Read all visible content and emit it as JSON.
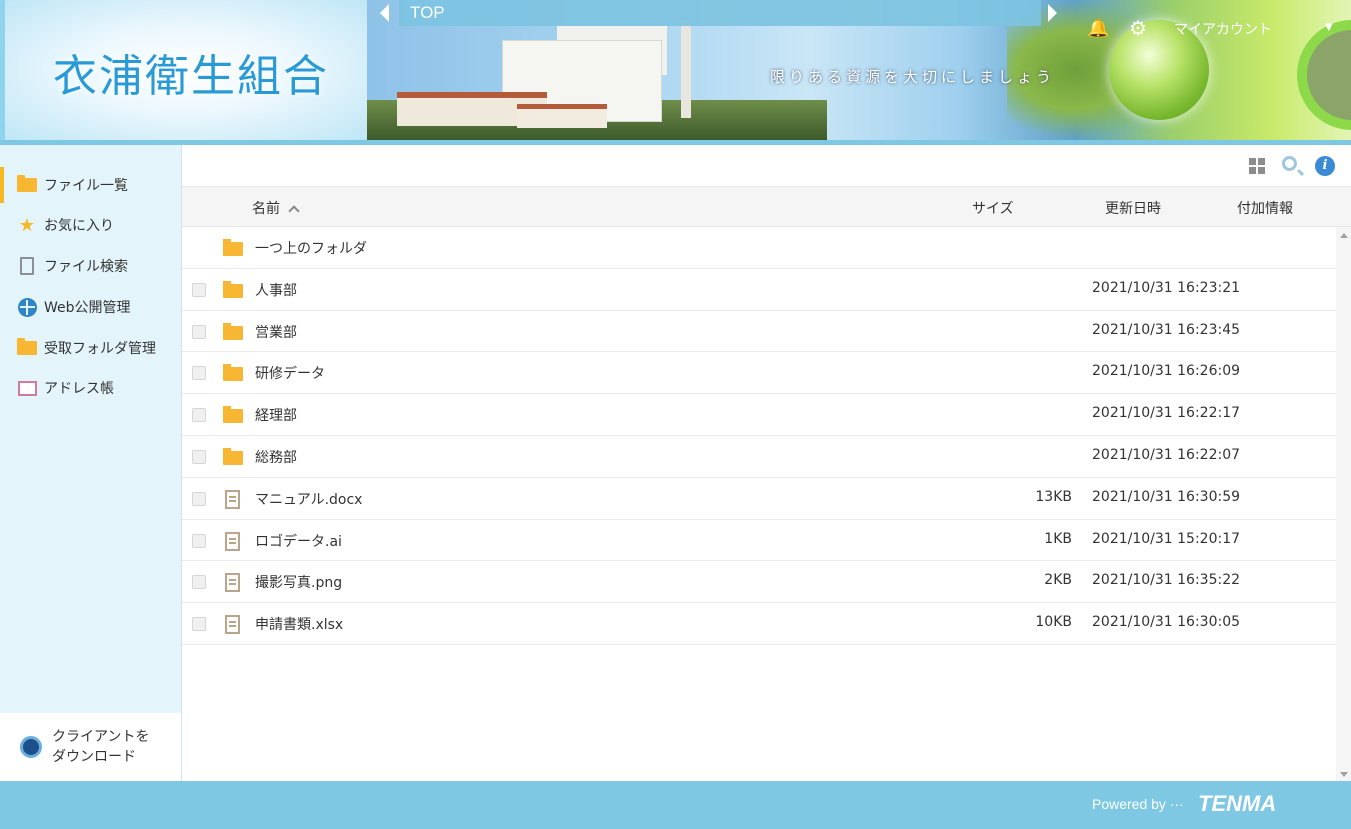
{
  "header": {
    "org_name": "衣浦衛生組合",
    "slogan": "限りある資源を大切にしましょう",
    "breadcrumb": "TOP",
    "account_label": "マイアカウント"
  },
  "sidebar": {
    "items": [
      {
        "label": "ファイル一覧",
        "icon": "folder-icon",
        "active": true
      },
      {
        "label": "お気に入り",
        "icon": "star-icon"
      },
      {
        "label": "ファイル検索",
        "icon": "search-document-icon"
      },
      {
        "label": "Web公開管理",
        "icon": "globe-icon"
      },
      {
        "label": "受取フォルダ管理",
        "icon": "shared-folder-icon"
      },
      {
        "label": "アドレス帳",
        "icon": "address-card-icon"
      }
    ],
    "download_label_line1": "クライアントを",
    "download_label_line2": "ダウンロード"
  },
  "table": {
    "columns": {
      "name": "名前",
      "size": "サイズ",
      "updated": "更新日時",
      "extra": "付加情報"
    },
    "parent_folder": "一つ上のフォルダ",
    "rows": [
      {
        "name": "人事部",
        "type": "folder",
        "size": "",
        "updated": "2021/10/31 16:23:21"
      },
      {
        "name": "営業部",
        "type": "folder",
        "size": "",
        "updated": "2021/10/31 16:23:45"
      },
      {
        "name": "研修データ",
        "type": "folder",
        "size": "",
        "updated": "2021/10/31 16:26:09"
      },
      {
        "name": "経理部",
        "type": "folder",
        "size": "",
        "updated": "2021/10/31 16:22:17"
      },
      {
        "name": "総務部",
        "type": "folder",
        "size": "",
        "updated": "2021/10/31 16:22:07"
      },
      {
        "name": "マニュアル.docx",
        "type": "file",
        "size": "13KB",
        "updated": "2021/10/31 16:30:59"
      },
      {
        "name": "ロゴデータ.ai",
        "type": "file",
        "size": "1KB",
        "updated": "2021/10/31 15:20:17"
      },
      {
        "name": "撮影写真.png",
        "type": "file",
        "size": "2KB",
        "updated": "2021/10/31 16:35:22"
      },
      {
        "name": "申請書類.xlsx",
        "type": "file",
        "size": "10KB",
        "updated": "2021/10/31 16:30:05"
      }
    ]
  },
  "footer": {
    "powered_by": "Powered by ···",
    "brand": "TENMA"
  },
  "colors": {
    "accent": "#7ec8e3",
    "sidebar_bg": "#e3f4fb",
    "folder": "#f7b733",
    "active_marker": "#f5b823"
  }
}
